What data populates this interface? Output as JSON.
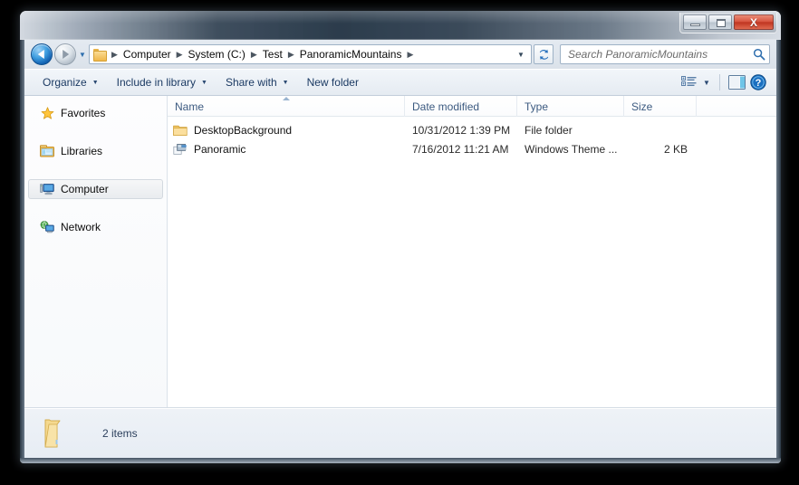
{
  "window": {
    "title": "",
    "controls": {
      "minimize_label": "Minimize",
      "maximize_label": "Maximize",
      "close_label": "X"
    }
  },
  "address_bar": {
    "back_label": "Back",
    "forward_label": "Forward",
    "history_caret": "▼",
    "folder_icon": "folder-icon",
    "breadcrumbs": [
      {
        "label": "Computer"
      },
      {
        "label": "System (C:)"
      },
      {
        "label": "Test"
      },
      {
        "label": "PanoramicMountains"
      }
    ],
    "separator": "▶",
    "dropdown_caret": "▼",
    "refresh_icon": "refresh-icon"
  },
  "search": {
    "placeholder": "Search PanoramicMountains",
    "value": "",
    "icon": "search-icon"
  },
  "toolbar": {
    "items": [
      {
        "label": "Organize",
        "has_caret": true
      },
      {
        "label": "Include in library",
        "has_caret": true
      },
      {
        "label": "Share with",
        "has_caret": true
      },
      {
        "label": "New folder",
        "has_caret": false
      }
    ],
    "caret": "▼",
    "view_icon": "view-list-icon",
    "view_caret": "▼",
    "preview_pane_icon": "preview-pane-icon",
    "help_icon": "help-icon",
    "help_glyph": "?"
  },
  "navigation_pane": {
    "items": [
      {
        "label": "Favorites",
        "icon": "star-icon",
        "selected": false
      },
      {
        "label": "Libraries",
        "icon": "libraries-icon",
        "selected": false
      },
      {
        "label": "Computer",
        "icon": "computer-icon",
        "selected": true
      },
      {
        "label": "Network",
        "icon": "network-icon",
        "selected": false
      }
    ]
  },
  "file_list": {
    "columns": [
      {
        "label": "Name",
        "sorted": true,
        "sort_direction": "ascending"
      },
      {
        "label": "Date modified",
        "sorted": false
      },
      {
        "label": "Type",
        "sorted": false
      },
      {
        "label": "Size",
        "sorted": false
      }
    ],
    "rows": [
      {
        "name": "DesktopBackground",
        "date_modified": "10/31/2012 1:39 PM",
        "type": "File folder",
        "size": "",
        "icon": "folder-icon"
      },
      {
        "name": "Panoramic",
        "date_modified": "7/16/2012 11:21 AM",
        "type": "Windows Theme ...",
        "size": "2 KB",
        "icon": "theme-file-icon"
      }
    ]
  },
  "status_bar": {
    "icon": "open-folder-icon",
    "text": "2 items"
  },
  "colors": {
    "accent_blue": "#1464b4",
    "close_red": "#bf3420",
    "header_text": "#3c5a80",
    "folder_yellow": "#efb74a"
  }
}
